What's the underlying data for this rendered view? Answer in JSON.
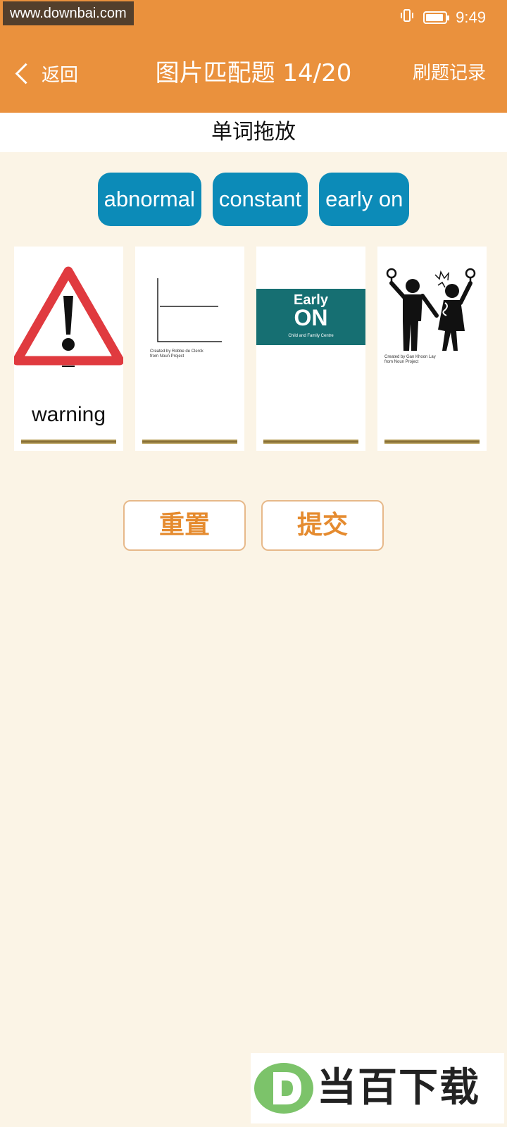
{
  "status_bar": {
    "watermark_url": "www.downbai.com",
    "time": "9:49"
  },
  "header": {
    "back_label": "返回",
    "title": "图片匹配题 14/20",
    "record_label": "刷题记录"
  },
  "subheader": {
    "title": "单词拖放"
  },
  "chips": [
    {
      "label": "abnormal"
    },
    {
      "label": "constant"
    },
    {
      "label": "early on"
    }
  ],
  "cards": [
    {
      "image": "warning-sign-icon",
      "caption": "warning"
    },
    {
      "image": "constant-line-chart-icon",
      "credit_lines": [
        "Created by Robbe de Clerck",
        "from Noun Project"
      ]
    },
    {
      "image": "early-on-logo",
      "logo_words": [
        "Early",
        "ON"
      ],
      "logo_sub": "Child and Family Centre"
    },
    {
      "image": "abnormal-people-icon",
      "credit_lines": [
        "Created by Gan Khoon Lay",
        "from Noun Project"
      ]
    }
  ],
  "actions": {
    "reset_label": "重置",
    "submit_label": "提交"
  },
  "watermark_bottom": {
    "text": "当百下载"
  },
  "colors": {
    "header_bg": "#ea913d",
    "page_bg": "#fbf4e6",
    "chip_bg": "#0c8bb8",
    "action_text": "#e58b2f",
    "logo_teal": "#166f72",
    "warning_red": "#e03a3f"
  }
}
